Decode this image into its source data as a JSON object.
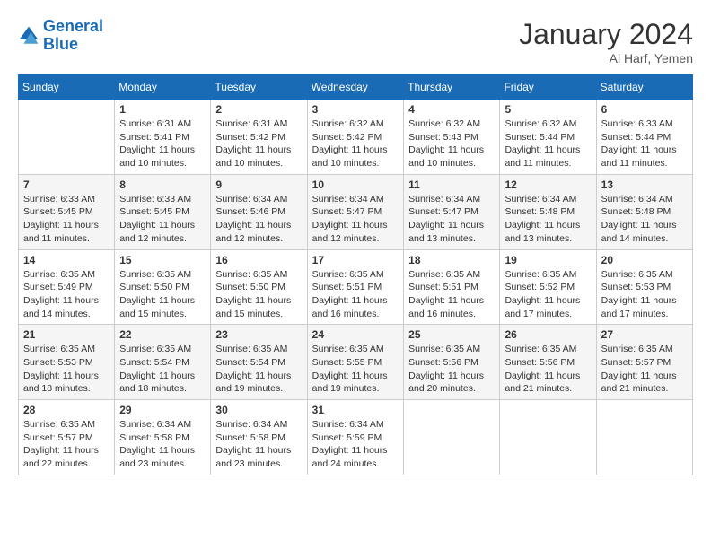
{
  "header": {
    "logo_line1": "General",
    "logo_line2": "Blue",
    "month_title": "January 2024",
    "location": "Al Harf, Yemen"
  },
  "weekdays": [
    "Sunday",
    "Monday",
    "Tuesday",
    "Wednesday",
    "Thursday",
    "Friday",
    "Saturday"
  ],
  "weeks": [
    [
      {
        "day": "",
        "sunrise": "",
        "sunset": "",
        "daylight": ""
      },
      {
        "day": "1",
        "sunrise": "Sunrise: 6:31 AM",
        "sunset": "Sunset: 5:41 PM",
        "daylight": "Daylight: 11 hours and 10 minutes."
      },
      {
        "day": "2",
        "sunrise": "Sunrise: 6:31 AM",
        "sunset": "Sunset: 5:42 PM",
        "daylight": "Daylight: 11 hours and 10 minutes."
      },
      {
        "day": "3",
        "sunrise": "Sunrise: 6:32 AM",
        "sunset": "Sunset: 5:42 PM",
        "daylight": "Daylight: 11 hours and 10 minutes."
      },
      {
        "day": "4",
        "sunrise": "Sunrise: 6:32 AM",
        "sunset": "Sunset: 5:43 PM",
        "daylight": "Daylight: 11 hours and 10 minutes."
      },
      {
        "day": "5",
        "sunrise": "Sunrise: 6:32 AM",
        "sunset": "Sunset: 5:44 PM",
        "daylight": "Daylight: 11 hours and 11 minutes."
      },
      {
        "day": "6",
        "sunrise": "Sunrise: 6:33 AM",
        "sunset": "Sunset: 5:44 PM",
        "daylight": "Daylight: 11 hours and 11 minutes."
      }
    ],
    [
      {
        "day": "7",
        "sunrise": "Sunrise: 6:33 AM",
        "sunset": "Sunset: 5:45 PM",
        "daylight": "Daylight: 11 hours and 11 minutes."
      },
      {
        "day": "8",
        "sunrise": "Sunrise: 6:33 AM",
        "sunset": "Sunset: 5:45 PM",
        "daylight": "Daylight: 11 hours and 12 minutes."
      },
      {
        "day": "9",
        "sunrise": "Sunrise: 6:34 AM",
        "sunset": "Sunset: 5:46 PM",
        "daylight": "Daylight: 11 hours and 12 minutes."
      },
      {
        "day": "10",
        "sunrise": "Sunrise: 6:34 AM",
        "sunset": "Sunset: 5:47 PM",
        "daylight": "Daylight: 11 hours and 12 minutes."
      },
      {
        "day": "11",
        "sunrise": "Sunrise: 6:34 AM",
        "sunset": "Sunset: 5:47 PM",
        "daylight": "Daylight: 11 hours and 13 minutes."
      },
      {
        "day": "12",
        "sunrise": "Sunrise: 6:34 AM",
        "sunset": "Sunset: 5:48 PM",
        "daylight": "Daylight: 11 hours and 13 minutes."
      },
      {
        "day": "13",
        "sunrise": "Sunrise: 6:34 AM",
        "sunset": "Sunset: 5:48 PM",
        "daylight": "Daylight: 11 hours and 14 minutes."
      }
    ],
    [
      {
        "day": "14",
        "sunrise": "Sunrise: 6:35 AM",
        "sunset": "Sunset: 5:49 PM",
        "daylight": "Daylight: 11 hours and 14 minutes."
      },
      {
        "day": "15",
        "sunrise": "Sunrise: 6:35 AM",
        "sunset": "Sunset: 5:50 PM",
        "daylight": "Daylight: 11 hours and 15 minutes."
      },
      {
        "day": "16",
        "sunrise": "Sunrise: 6:35 AM",
        "sunset": "Sunset: 5:50 PM",
        "daylight": "Daylight: 11 hours and 15 minutes."
      },
      {
        "day": "17",
        "sunrise": "Sunrise: 6:35 AM",
        "sunset": "Sunset: 5:51 PM",
        "daylight": "Daylight: 11 hours and 16 minutes."
      },
      {
        "day": "18",
        "sunrise": "Sunrise: 6:35 AM",
        "sunset": "Sunset: 5:51 PM",
        "daylight": "Daylight: 11 hours and 16 minutes."
      },
      {
        "day": "19",
        "sunrise": "Sunrise: 6:35 AM",
        "sunset": "Sunset: 5:52 PM",
        "daylight": "Daylight: 11 hours and 17 minutes."
      },
      {
        "day": "20",
        "sunrise": "Sunrise: 6:35 AM",
        "sunset": "Sunset: 5:53 PM",
        "daylight": "Daylight: 11 hours and 17 minutes."
      }
    ],
    [
      {
        "day": "21",
        "sunrise": "Sunrise: 6:35 AM",
        "sunset": "Sunset: 5:53 PM",
        "daylight": "Daylight: 11 hours and 18 minutes."
      },
      {
        "day": "22",
        "sunrise": "Sunrise: 6:35 AM",
        "sunset": "Sunset: 5:54 PM",
        "daylight": "Daylight: 11 hours and 18 minutes."
      },
      {
        "day": "23",
        "sunrise": "Sunrise: 6:35 AM",
        "sunset": "Sunset: 5:54 PM",
        "daylight": "Daylight: 11 hours and 19 minutes."
      },
      {
        "day": "24",
        "sunrise": "Sunrise: 6:35 AM",
        "sunset": "Sunset: 5:55 PM",
        "daylight": "Daylight: 11 hours and 19 minutes."
      },
      {
        "day": "25",
        "sunrise": "Sunrise: 6:35 AM",
        "sunset": "Sunset: 5:56 PM",
        "daylight": "Daylight: 11 hours and 20 minutes."
      },
      {
        "day": "26",
        "sunrise": "Sunrise: 6:35 AM",
        "sunset": "Sunset: 5:56 PM",
        "daylight": "Daylight: 11 hours and 21 minutes."
      },
      {
        "day": "27",
        "sunrise": "Sunrise: 6:35 AM",
        "sunset": "Sunset: 5:57 PM",
        "daylight": "Daylight: 11 hours and 21 minutes."
      }
    ],
    [
      {
        "day": "28",
        "sunrise": "Sunrise: 6:35 AM",
        "sunset": "Sunset: 5:57 PM",
        "daylight": "Daylight: 11 hours and 22 minutes."
      },
      {
        "day": "29",
        "sunrise": "Sunrise: 6:34 AM",
        "sunset": "Sunset: 5:58 PM",
        "daylight": "Daylight: 11 hours and 23 minutes."
      },
      {
        "day": "30",
        "sunrise": "Sunrise: 6:34 AM",
        "sunset": "Sunset: 5:58 PM",
        "daylight": "Daylight: 11 hours and 23 minutes."
      },
      {
        "day": "31",
        "sunrise": "Sunrise: 6:34 AM",
        "sunset": "Sunset: 5:59 PM",
        "daylight": "Daylight: 11 hours and 24 minutes."
      },
      {
        "day": "",
        "sunrise": "",
        "sunset": "",
        "daylight": ""
      },
      {
        "day": "",
        "sunrise": "",
        "sunset": "",
        "daylight": ""
      },
      {
        "day": "",
        "sunrise": "",
        "sunset": "",
        "daylight": ""
      }
    ]
  ]
}
